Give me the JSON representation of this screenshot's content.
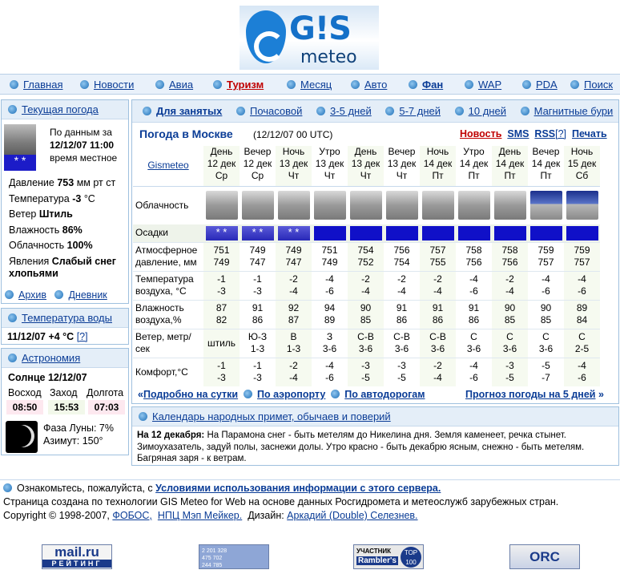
{
  "logo": {
    "text_gis": "G!S",
    "text_meteo": "meteo"
  },
  "nav": [
    "Главная",
    "Новости",
    "Авиа",
    "Туризм",
    "Месяц",
    "Авто",
    "Фан",
    "WAP",
    "PDA",
    "Поиск"
  ],
  "current": {
    "title": "Текущая погода",
    "note1": "По данным за",
    "note2": "12/12/07 11:00",
    "note3": "время местное",
    "pressure_label": "Давление",
    "pressure_val": "753",
    "pressure_unit": "мм рт ст",
    "temp_label": "Температура",
    "temp_val": "-3",
    "temp_unit": "°C",
    "wind_label": "Ветер",
    "wind_val": "Штиль",
    "hum_label": "Влажность",
    "hum_val": "86%",
    "cloud_label": "Облачность",
    "cloud_val": "100%",
    "phen_label": "Явления",
    "phen_val": "Слабый снег хлопьями",
    "archive": "Архив",
    "diary": "Дневник"
  },
  "water": {
    "title": "Температура воды",
    "date": "11/12/07",
    "val": "+4 °C",
    "help": "[?]"
  },
  "astro": {
    "title": "Астрономия",
    "sun": "Солнце 12/12/07",
    "rise_l": "Восход",
    "set_l": "Заход",
    "len_l": "Долгота",
    "rise": "08:50",
    "set": "15:53",
    "len": "07:03",
    "phase": "Фаза Луны: 7%",
    "azimuth": "Азимут: 150°"
  },
  "tabs": [
    "Для занятых",
    "Почасовой",
    "3-5 дней",
    "5-7 дней",
    "10 дней",
    "Магнитные бури"
  ],
  "forecast": {
    "title": "Погода в Москве",
    "time": "(12/12/07 00 UTC)",
    "new": "Новость",
    "sms": "SMS",
    "rss": "RSS",
    "rss_q": "[?]",
    "print": "Печать",
    "source": "Gismeteo",
    "rows": {
      "clouds": "Облачность",
      "precip": "Осадки",
      "pressure": "Атмосферное давление, мм",
      "temp": "Температура воздуха, °C",
      "hum": "Влажность воздуха,%",
      "wind": "Ветер, метр/сек",
      "comfort": "Комфорт,°C"
    },
    "cols": [
      {
        "tod": "День",
        "date": "12 дек",
        "dow": "Ср",
        "night": false,
        "snow": "*  *",
        "p1": "751",
        "p2": "749",
        "t1": "-1",
        "t2": "-3",
        "h1": "87",
        "h2": "82",
        "w1": "штиль",
        "w2": "",
        "c1": "-1",
        "c2": "-3"
      },
      {
        "tod": "Вечер",
        "date": "12 дек",
        "dow": "Ср",
        "night": false,
        "snow": "* *",
        "p1": "749",
        "p2": "747",
        "t1": "-1",
        "t2": "-3",
        "h1": "91",
        "h2": "86",
        "w1": "Ю-З",
        "w2": "1-3",
        "c1": "-1",
        "c2": "-3"
      },
      {
        "tod": "Ночь",
        "date": "13 дек",
        "dow": "Чт",
        "night": false,
        "snow": "* *",
        "p1": "749",
        "p2": "747",
        "t1": "-2",
        "t2": "-4",
        "h1": "92",
        "h2": "87",
        "w1": "В",
        "w2": "1-3",
        "c1": "-2",
        "c2": "-4"
      },
      {
        "tod": "Утро",
        "date": "13 дек",
        "dow": "Чт",
        "night": false,
        "snow": "",
        "p1": "751",
        "p2": "749",
        "t1": "-4",
        "t2": "-6",
        "h1": "94",
        "h2": "89",
        "w1": "З",
        "w2": "3-6",
        "c1": "-4",
        "c2": "-6"
      },
      {
        "tod": "День",
        "date": "13 дек",
        "dow": "Чт",
        "night": false,
        "snow": "",
        "p1": "754",
        "p2": "752",
        "t1": "-2",
        "t2": "-4",
        "h1": "90",
        "h2": "85",
        "w1": "С-В",
        "w2": "3-6",
        "c1": "-3",
        "c2": "-5"
      },
      {
        "tod": "Вечер",
        "date": "13 дек",
        "dow": "Чт",
        "night": false,
        "snow": "",
        "p1": "756",
        "p2": "754",
        "t1": "-2",
        "t2": "-4",
        "h1": "91",
        "h2": "86",
        "w1": "С-В",
        "w2": "3-6",
        "c1": "-3",
        "c2": "-5"
      },
      {
        "tod": "Ночь",
        "date": "14 дек",
        "dow": "Пт",
        "night": false,
        "snow": "",
        "p1": "757",
        "p2": "755",
        "t1": "-2",
        "t2": "-4",
        "h1": "91",
        "h2": "86",
        "w1": "С-В",
        "w2": "3-6",
        "c1": "-2",
        "c2": "-4"
      },
      {
        "tod": "Утро",
        "date": "14 дек",
        "dow": "Пт",
        "night": false,
        "snow": "",
        "p1": "758",
        "p2": "756",
        "t1": "-4",
        "t2": "-6",
        "h1": "91",
        "h2": "86",
        "w1": "С",
        "w2": "3-6",
        "c1": "-4",
        "c2": "-6"
      },
      {
        "tod": "День",
        "date": "14 дек",
        "dow": "Пт",
        "night": false,
        "snow": "",
        "p1": "758",
        "p2": "756",
        "t1": "-2",
        "t2": "-4",
        "h1": "90",
        "h2": "85",
        "w1": "С",
        "w2": "3-6",
        "c1": "-3",
        "c2": "-5"
      },
      {
        "tod": "Вечер",
        "date": "14 дек",
        "dow": "Пт",
        "night": true,
        "snow": "",
        "p1": "759",
        "p2": "757",
        "t1": "-4",
        "t2": "-6",
        "h1": "90",
        "h2": "85",
        "w1": "С",
        "w2": "3-6",
        "c1": "-5",
        "c2": "-7"
      },
      {
        "tod": "Ночь",
        "date": "15 дек",
        "dow": "Сб",
        "night": true,
        "snow": "",
        "p1": "759",
        "p2": "757",
        "t1": "-4",
        "t2": "-6",
        "h1": "89",
        "h2": "84",
        "w1": "С",
        "w2": "2-5",
        "c1": "-4",
        "c2": "-6"
      }
    ]
  },
  "links": {
    "day": "Подробно на сутки",
    "airport": "По аэропорту",
    "roads": "По автодорогам",
    "five": "Прогноз погоды на 5 дней"
  },
  "calendar": {
    "title": "Календарь народных примет, обычаев и поверий",
    "date": "На 12 декабря:",
    "text": "На Парамона снег - быть метелям до Никелина дня. Земля каменеет, речка стынет. Зимоухазатель, задуй полы, заснежи долы. Утро красно - быть декабрю ясным, снежно - быть метелям. Багряная заря - к ветрам."
  },
  "footer": {
    "l1a": "Ознакомьтесь, пожалуйста, с ",
    "l1b": "Условиями использования информации с этого сервера.",
    "l2": "Страница создана по технологии GIS Meteo for Web на основе данных Росгидромета и метеослужб зарубежных стран.",
    "l3a": "Copyright © 1998-2007, ",
    "fobos": "ФОБОС,",
    "npc": "НПЦ Мэп Мейкер.",
    "design": "Дизайн: ",
    "author": "Аркадий (Double) Селезнев."
  },
  "banners": {
    "mail1": "mail.ru",
    "mail2": "РЕЙТИНГ",
    "counter": "2 201 328\n475 702\n244 785",
    "ramb1": "УЧАСТНИК",
    "ramb2": "Rambler's",
    "ramb3": "TOP 100",
    "orc": "ORC"
  }
}
